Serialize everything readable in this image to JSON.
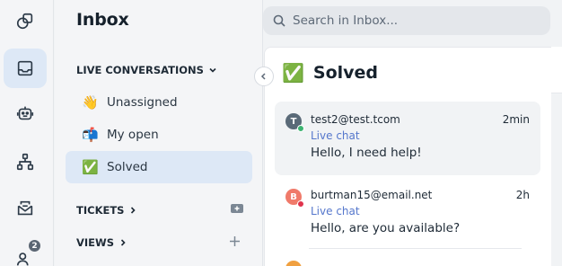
{
  "rail": {
    "items": [
      {
        "name": "shapes-icon",
        "active": false
      },
      {
        "name": "inbox-icon",
        "active": true
      },
      {
        "name": "bot-icon",
        "active": false
      },
      {
        "name": "workflow-icon",
        "active": false
      },
      {
        "name": "mail-icon",
        "active": false
      },
      {
        "name": "contacts-icon",
        "active": false
      }
    ],
    "contacts_badge": "2"
  },
  "sidebar": {
    "title": "Inbox",
    "live_label": "LIVE CONVERSATIONS",
    "items": [
      {
        "emoji": "👋",
        "label": "Unassigned",
        "active": false
      },
      {
        "emoji": "📬",
        "label": "My open",
        "active": false
      },
      {
        "emoji": "✅",
        "label": "Solved",
        "active": true
      }
    ],
    "tickets_label": "TICKETS",
    "views_label": "VIEWS"
  },
  "search": {
    "placeholder": "Search in Inbox..."
  },
  "list": {
    "title_emoji": "✅",
    "title": "Solved",
    "conversations": [
      {
        "initial": "T",
        "avatar_color": "#5a6a78",
        "status_color": "#3cb371",
        "email": "test2@test.tcom",
        "time": "2min",
        "channel": "Live chat",
        "preview": "Hello, I need help!",
        "selected": true
      },
      {
        "initial": "B",
        "avatar_color": "#f07a6a",
        "status_color": "#e0334c",
        "email": "burtman15@email.net",
        "time": "2h",
        "channel": "Live chat",
        "preview": "Hello, are you available?",
        "selected": false
      }
    ]
  },
  "colors": {
    "accent": "#dde8f6",
    "link": "#5577cc"
  }
}
